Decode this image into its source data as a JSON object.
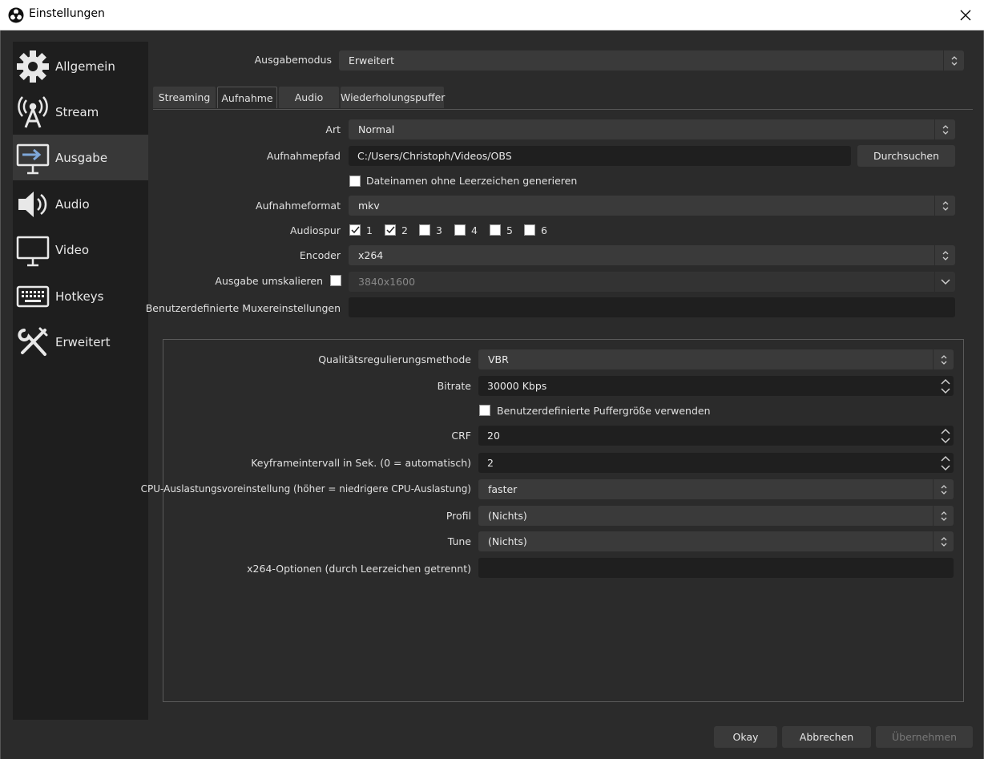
{
  "window": {
    "title": "Einstellungen"
  },
  "sidebar": {
    "items": [
      {
        "label": "Allgemein",
        "icon": "gear-icon"
      },
      {
        "label": "Stream",
        "icon": "antenna-icon"
      },
      {
        "label": "Ausgabe",
        "icon": "output-icon"
      },
      {
        "label": "Audio",
        "icon": "speaker-icon"
      },
      {
        "label": "Video",
        "icon": "monitor-icon"
      },
      {
        "label": "Hotkeys",
        "icon": "keyboard-icon"
      },
      {
        "label": "Erweitert",
        "icon": "tools-icon"
      }
    ],
    "active_index": 2
  },
  "output_mode": {
    "label": "Ausgabemodus",
    "value": "Erweitert"
  },
  "tabs": [
    "Streaming",
    "Aufnahme",
    "Audio",
    "Wiederholungspuffer"
  ],
  "recording": {
    "type": {
      "label": "Art",
      "value": "Normal"
    },
    "path": {
      "label": "Aufnahmepfad",
      "value": "C:/Users/Christoph/Videos/OBS",
      "browse": "Durchsuchen"
    },
    "no_spaces": {
      "label": "Dateinamen ohne Leerzeichen generieren"
    },
    "format": {
      "label": "Aufnahmeformat",
      "value": "mkv"
    },
    "tracks": {
      "label": "Audiospur",
      "items": [
        "1",
        "2",
        "3",
        "4",
        "5",
        "6"
      ]
    },
    "encoder": {
      "label": "Encoder",
      "value": "x264"
    },
    "rescale": {
      "label": "Ausgabe umskalieren",
      "value": "3840x1600"
    },
    "muxer": {
      "label": "Benutzerdefinierte Muxereinstellungen",
      "value": ""
    }
  },
  "encoder_settings": {
    "rate_control": {
      "label": "Qualitätsregulierungsmethode",
      "value": "VBR"
    },
    "bitrate": {
      "label": "Bitrate",
      "value": "30000 Kbps"
    },
    "custom_buffer": {
      "label": "Benutzerdefinierte Puffergröße verwenden"
    },
    "crf": {
      "label": "CRF",
      "value": "20"
    },
    "keyframe": {
      "label": "Keyframeintervall in Sek. (0 = automatisch)",
      "value": "2"
    },
    "preset": {
      "label": "CPU-Auslastungsvoreinstellung (höher = niedrigere CPU-Auslastung)",
      "value": "faster"
    },
    "profile": {
      "label": "Profil",
      "value": "(Nichts)"
    },
    "tune": {
      "label": "Tune",
      "value": "(Nichts)"
    },
    "options": {
      "label": "x264-Optionen (durch Leerzeichen getrennt)",
      "value": ""
    }
  },
  "footer": {
    "ok": "Okay",
    "cancel": "Abbrechen",
    "apply": "Übernehmen"
  }
}
